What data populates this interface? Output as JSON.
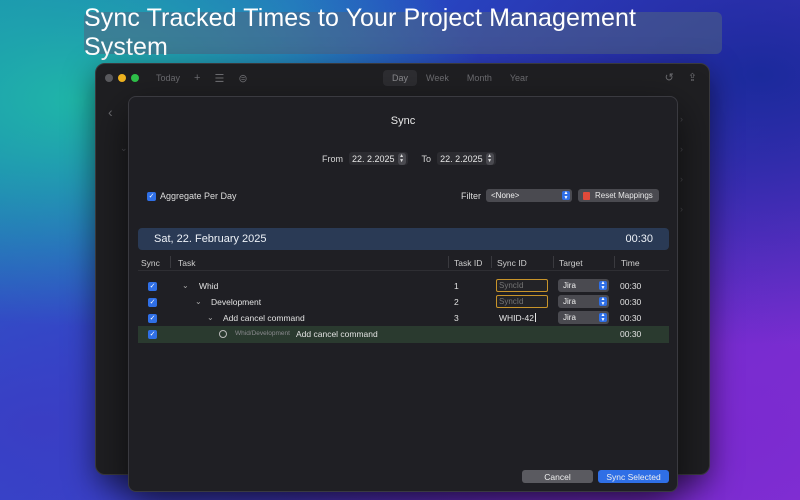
{
  "banner": {
    "title": "Sync Tracked Times to Your Project Management System"
  },
  "app": {
    "toolbar": {
      "today_label": "Today",
      "icons": [
        "plus-icon",
        "list-icon",
        "filter-icon"
      ],
      "segments": [
        "Day",
        "Week",
        "Month",
        "Year"
      ],
      "active_segment": "Day",
      "right_icons": [
        "history-icon",
        "share-icon"
      ]
    }
  },
  "sheet": {
    "title": "Sync",
    "range": {
      "from_label": "From",
      "from_value": "22.  2.2025",
      "to_label": "To",
      "to_value": "22.  2.2025"
    },
    "aggregate": {
      "label": "Aggregate Per Day",
      "checked": true
    },
    "filter": {
      "label": "Filter",
      "value": "<None>",
      "reset_label": "Reset Mappings"
    },
    "day": {
      "date": "Sat, 22. February 2025",
      "total": "00:30"
    },
    "columns": {
      "sync": "Sync",
      "task": "Task",
      "task_id": "Task ID",
      "sync_id": "Sync ID",
      "target": "Target",
      "time": "Time"
    },
    "rows": [
      {
        "task": "Whid",
        "task_id": "1",
        "sync_id": "",
        "sync_id_placeholder": "SyncId",
        "target": "Jira",
        "time": "00:30"
      },
      {
        "task": "Development",
        "task_id": "2",
        "sync_id": "",
        "sync_id_placeholder": "SyncId",
        "target": "Jira",
        "time": "00:30"
      },
      {
        "task": "Add cancel command",
        "task_id": "3",
        "sync_id": "WHID-42",
        "target": "Jira",
        "time": "00:30"
      }
    ],
    "entry": {
      "path": "Whid/Development",
      "description": "Add cancel command",
      "time": "00:30"
    },
    "buttons": {
      "cancel": "Cancel",
      "sync": "Sync Selected"
    },
    "colors": {
      "accent": "#2f6fe6",
      "day_bar": "#2a3a55",
      "highlight_row": "#2a3a2f",
      "syncid_border": "#c8942a"
    }
  }
}
